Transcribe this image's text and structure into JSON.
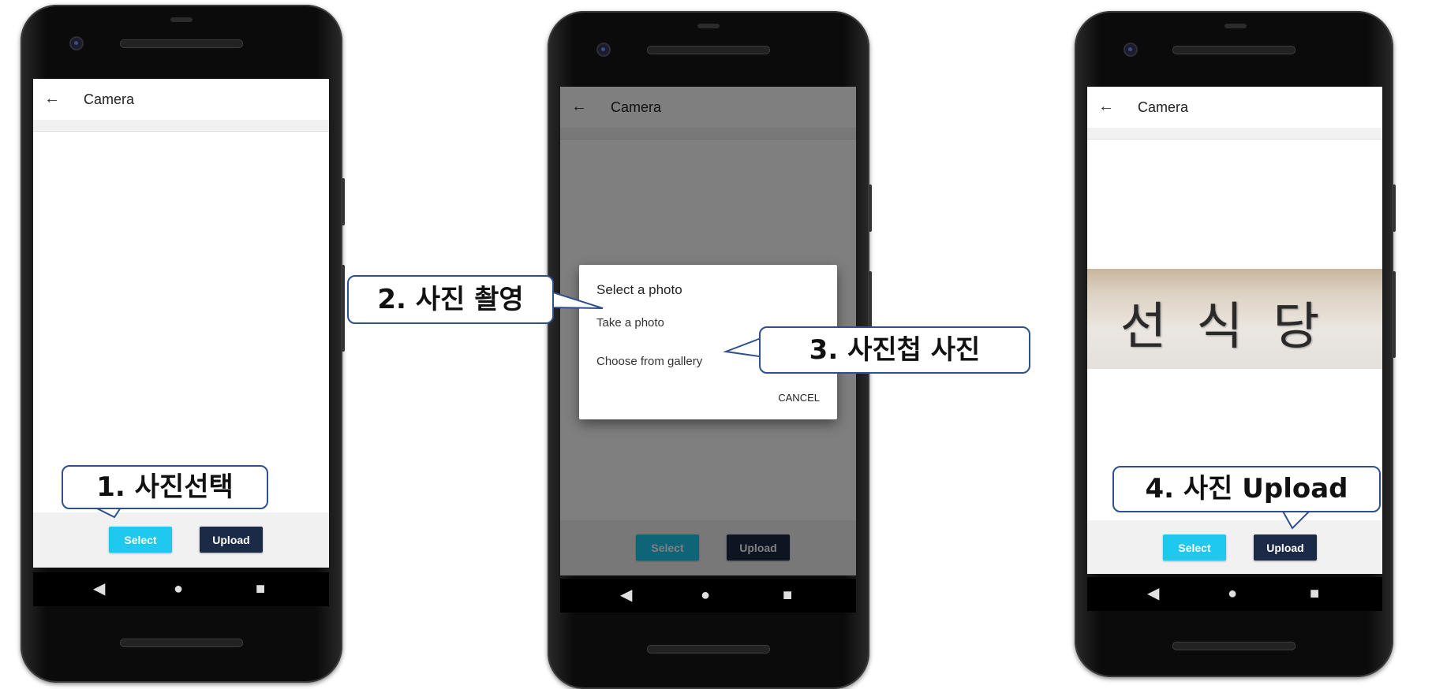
{
  "screens": [
    {
      "appbar": {
        "back_icon": "←",
        "title": "Camera"
      },
      "buttons": {
        "select": "Select",
        "upload": "Upload"
      },
      "nav": {
        "back": "◀",
        "home": "●",
        "recents": "■"
      },
      "callout": "1. 사진선택"
    },
    {
      "appbar": {
        "back_icon": "←",
        "title": "Camera"
      },
      "buttons": {
        "select": "Select",
        "upload": "Upload"
      },
      "nav": {
        "back": "◀",
        "home": "●",
        "recents": "■"
      },
      "dialog": {
        "title": "Select a photo",
        "option_take": "Take a photo",
        "option_gallery": "Choose from gallery",
        "cancel": "CANCEL"
      },
      "callouts": [
        "2. 사진 촬영",
        "3. 사진첩 사진"
      ]
    },
    {
      "appbar": {
        "back_icon": "←",
        "title": "Camera"
      },
      "buttons": {
        "select": "Select",
        "upload": "Upload"
      },
      "nav": {
        "back": "◀",
        "home": "●",
        "recents": "■"
      },
      "photo_text": "선식당",
      "callout": "4. 사진 Upload"
    }
  ],
  "colors": {
    "select_button": "#1ec8ef",
    "upload_button": "#1b2b47",
    "callout_border": "#2f4f8f"
  }
}
